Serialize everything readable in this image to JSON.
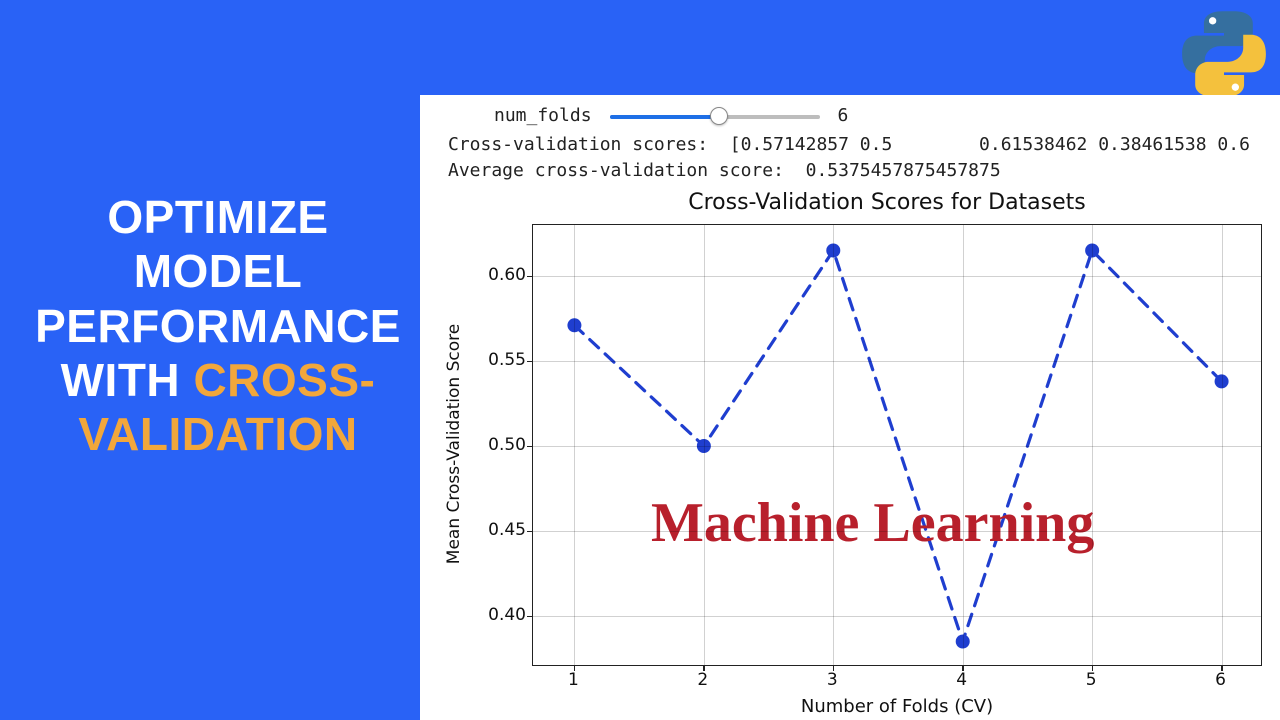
{
  "headline": {
    "line1": "OPTIMIZE",
    "line2": "MODEL",
    "line3": "PERFORMANCE",
    "line4": "WITH ",
    "accent": "CROSS-VALIDATION"
  },
  "slider": {
    "label": "num_folds",
    "value": "6"
  },
  "console": {
    "scores_label": "Cross-validation scores:  ",
    "scores_value": "[0.57142857 0.5        0.61538462 0.38461538 0.6",
    "avg_label": "Average cross-validation score:  ",
    "avg_value": "0.5375457875457875"
  },
  "overlay": "Machine Learning",
  "chart_data": {
    "type": "line",
    "title": "Cross-Validation Scores for Datasets",
    "xlabel": "Number of Folds (CV)",
    "ylabel": "Mean Cross-Validation Score",
    "x": [
      1,
      2,
      3,
      4,
      5,
      6
    ],
    "values": [
      0.571,
      0.5,
      0.615,
      0.385,
      0.615,
      0.538
    ],
    "ylim": [
      0.37,
      0.63
    ],
    "yticks": [
      0.4,
      0.45,
      0.5,
      0.55,
      0.6
    ],
    "xticks": [
      1,
      2,
      3,
      4,
      5,
      6
    ],
    "grid": true,
    "marker": "o",
    "linestyle": "dashed",
    "color": "#1f3ecf"
  }
}
